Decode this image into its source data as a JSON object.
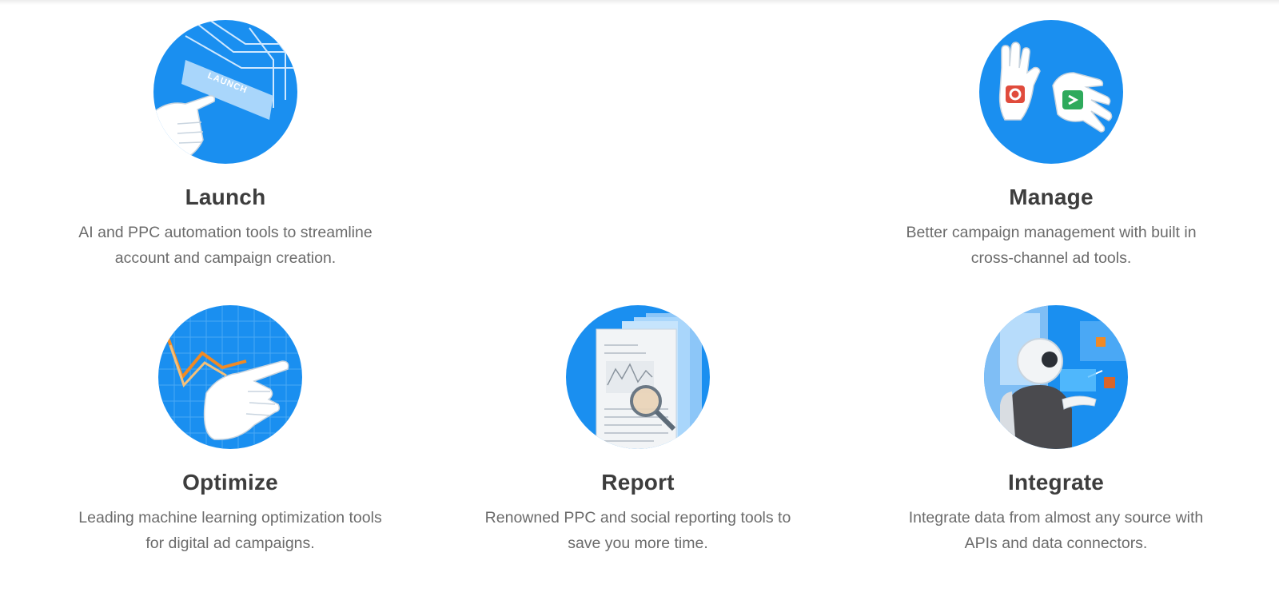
{
  "features": {
    "launch": {
      "title": "Launch",
      "description": "AI and PPC automation tools to streamline account and campaign creation.",
      "illustration_text": "LAUNCH",
      "icon": "launch-hand-icon"
    },
    "manage": {
      "title": "Manage",
      "description": "Better campaign management with built in cross-channel ad tools.",
      "icon": "stop-go-hands-icon"
    },
    "optimize": {
      "title": "Optimize",
      "description": "Leading machine learning optimization tools for digital ad campaigns.",
      "icon": "pointing-chart-icon"
    },
    "report": {
      "title": "Report",
      "description": "Renowned PPC and social reporting tools to save you more time.",
      "icon": "report-magnifier-icon"
    },
    "integrate": {
      "title": "Integrate",
      "description": "Integrate data from almost any source with APIs and data connectors.",
      "icon": "robot-integrate-icon"
    }
  },
  "colors": {
    "accent_blue": "#1a8ff0",
    "title_text": "#3d3d3d",
    "body_text": "#6b6b6b"
  }
}
